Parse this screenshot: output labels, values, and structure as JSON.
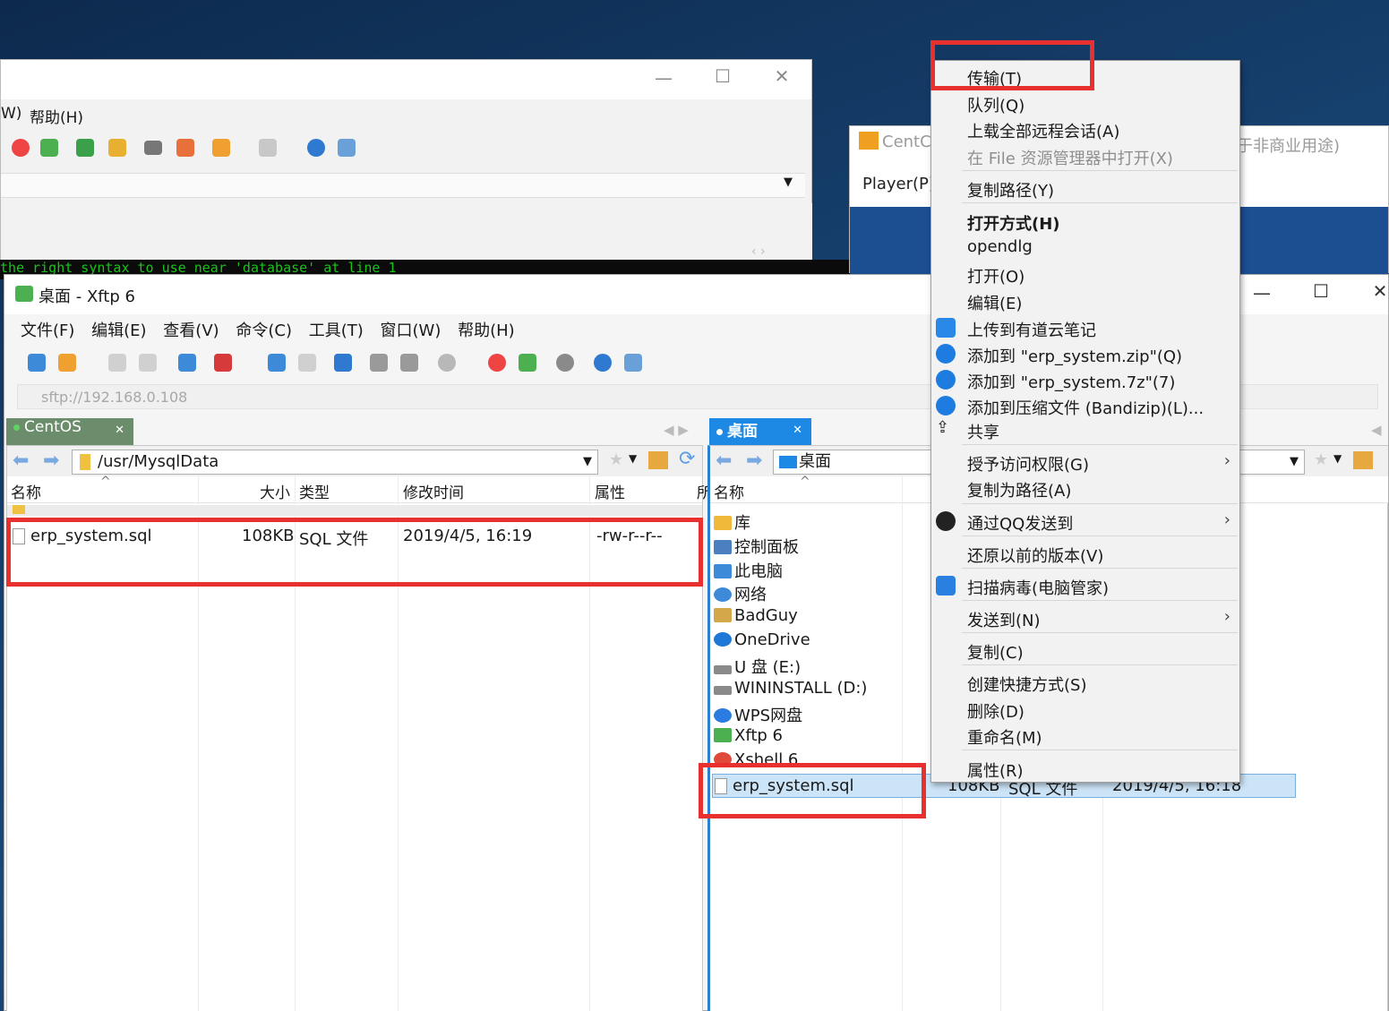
{
  "bg_window": {
    "menu": [
      "W)",
      "帮助(H)"
    ],
    "terminal_text": "the right syntax to use near 'database' at line 1"
  },
  "vm_window": {
    "title": "CentC",
    "right_text": "于非商业用途)",
    "menu": "Player(P)"
  },
  "xftp": {
    "title": "桌面 - Xftp 6",
    "menu": [
      "文件(F)",
      "编辑(E)",
      "查看(V)",
      "命令(C)",
      "工具(T)",
      "窗口(W)",
      "帮助(H)"
    ],
    "address": "sftp://192.168.0.108",
    "left_tab": "CentOS",
    "right_tab": "桌面",
    "left_pane": {
      "path": "/usr/MysqlData",
      "columns": [
        "名称",
        "大小",
        "类型",
        "修改时间",
        "属性",
        "所"
      ],
      "files": [
        {
          "name": "erp_system.sql",
          "size": "108KB",
          "type": "SQL 文件",
          "modified": "2019/4/5, 16:19",
          "attr": "-rw-r--r--"
        }
      ]
    },
    "right_pane": {
      "path": "桌面",
      "column_name": "名称",
      "items": [
        {
          "label": "库",
          "icon": "library-icon",
          "color": "#f0b93a"
        },
        {
          "label": "控制面板",
          "icon": "control-panel-icon",
          "color": "#4a7fc0"
        },
        {
          "label": "此电脑",
          "icon": "computer-icon",
          "color": "#3c8ad8"
        },
        {
          "label": "网络",
          "icon": "network-icon",
          "color": "#3c8ad8"
        },
        {
          "label": "BadGuy",
          "icon": "user-folder-icon",
          "color": "#d4a84a"
        },
        {
          "label": "OneDrive",
          "icon": "onedrive-icon",
          "color": "#1d78d8"
        },
        {
          "label": "U 盘 (E:)",
          "icon": "usb-drive-icon",
          "color": "#8a8a8a"
        },
        {
          "label": "WININSTALL (D:)",
          "icon": "drive-icon",
          "color": "#8a8a8a"
        },
        {
          "label": "WPS网盘",
          "icon": "wps-cloud-icon",
          "color": "#2b7ce0"
        },
        {
          "label": "Xftp 6",
          "icon": "xftp-icon",
          "color": "#4caf50"
        },
        {
          "label": "Xshell 6",
          "icon": "xshell-icon",
          "color": "#e04a3a"
        }
      ],
      "selected_file": {
        "name": "erp_system.sql",
        "size": "108KB",
        "type": "SQL 文件",
        "modified": "2019/4/5, 16:18"
      }
    }
  },
  "context_menu": {
    "items": [
      {
        "label": "传输(T)",
        "style": "normal"
      },
      {
        "label": "队列(Q)",
        "style": "normal"
      },
      {
        "label": "上载全部远程会话(A)",
        "style": "normal"
      },
      {
        "label": "在 File 资源管理器中打开(X)",
        "style": "disabled"
      },
      {
        "label": "复制路径(Y)",
        "style": "normal"
      },
      {
        "label": "打开方式(H)",
        "style": "bold"
      },
      {
        "label": "opendlg",
        "style": "normal"
      },
      {
        "label": "打开(O)",
        "style": "normal"
      },
      {
        "label": "编辑(E)",
        "style": "normal"
      },
      {
        "label": "上传到有道云笔记",
        "style": "normal"
      },
      {
        "label": "添加到 \"erp_system.zip\"(Q)",
        "style": "normal"
      },
      {
        "label": "添加到 \"erp_system.7z\"(7)",
        "style": "normal"
      },
      {
        "label": "添加到压缩文件 (Bandizip)(L)...",
        "style": "normal"
      },
      {
        "label": "共享",
        "style": "normal"
      },
      {
        "label": "授予访问权限(G)",
        "style": "normal"
      },
      {
        "label": "复制为路径(A)",
        "style": "normal"
      },
      {
        "label": "通过QQ发送到",
        "style": "normal"
      },
      {
        "label": "还原以前的版本(V)",
        "style": "normal"
      },
      {
        "label": "扫描病毒(电脑管家)",
        "style": "normal"
      },
      {
        "label": "发送到(N)",
        "style": "normal"
      },
      {
        "label": "复制(C)",
        "style": "normal"
      },
      {
        "label": "创建快捷方式(S)",
        "style": "normal"
      },
      {
        "label": "删除(D)",
        "style": "normal"
      },
      {
        "label": "重命名(M)",
        "style": "normal"
      },
      {
        "label": "属性(R)",
        "style": "normal"
      }
    ]
  },
  "colors": {
    "highlight_red": "#e8312f",
    "tab_left": "#5a8f5a",
    "tab_right": "#1e88e5",
    "selection": "#cce4f7"
  }
}
